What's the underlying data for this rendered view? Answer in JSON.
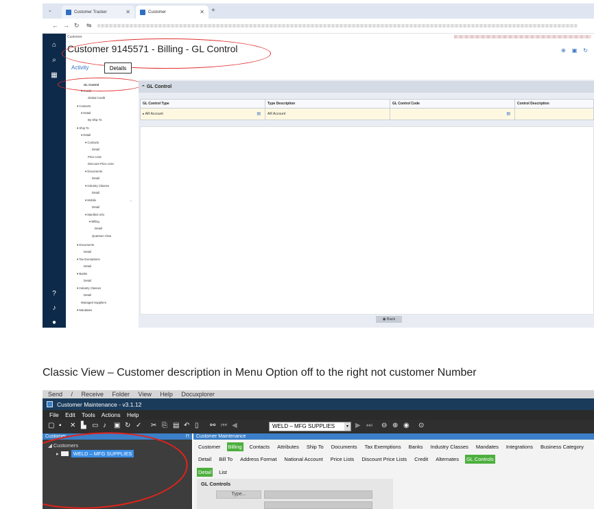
{
  "top": {
    "tabs": [
      {
        "label": "Customer Tracker"
      },
      {
        "label": "Customer"
      }
    ],
    "crumb": "Customer",
    "page_title": "Customer 9145571 - Billing - GL Control",
    "view_tabs": {
      "activity": "Activity",
      "details": "Details"
    },
    "tree": [
      "GL Control",
      "Credit",
      "Global Credit",
      "Contacts",
      "Detail",
      "By Ship To",
      "Ship To",
      "Detail",
      "Contacts",
      "Detail",
      "Price Lists",
      "Discount Price Lists",
      "Documents",
      "Detail",
      "Industry Classes",
      "Detail",
      "Mobile",
      "Detail",
      "Manifest Info",
      "Billing",
      "Detail",
      "Quantum View",
      "Documents",
      "Detail",
      "Tax Exemptions",
      "Detail",
      "Banks",
      "Detail",
      "Industry Classes",
      "Detail",
      "Managed Suppliers",
      "Mandates"
    ],
    "section": "GL Control",
    "grid": {
      "headers": [
        "GL Control Type",
        "Type Description",
        "GL Control Code",
        "Control Description"
      ],
      "row": [
        "AR Account",
        "AR Account",
        "",
        ""
      ]
    },
    "back_label": "Back"
  },
  "caption": "Classic View – Customer description in Menu Option off to the right not customer Number",
  "bottom": {
    "menu_strip": "Send / Receive  Folder  View  Help  Docuxplorer",
    "window_title": "Customer Maintenance - v3.1.12",
    "menu": [
      "File",
      "Edit",
      "Tools",
      "Actions",
      "Help"
    ],
    "record": "WELD – MFG SUPPLIES",
    "left_header": "Customer",
    "pin": "⊓",
    "tree_root": "Customers",
    "tree_child": "WELD – MFG SUPPLIES",
    "right_header": "Customer Maintenance",
    "tabs1": [
      "Customer",
      "Billing",
      "Contacts",
      "Attributes",
      "Ship To",
      "Documents",
      "Tax Exemptions",
      "Banks",
      "Industry Classes",
      "Mandates",
      "Integrations",
      "Business Category"
    ],
    "tabs2": [
      "Detail",
      "Bill To",
      "Address Format",
      "National Account",
      "Price Lists",
      "Discount Price Lists",
      "Credit",
      "Alternates",
      "GL Controls"
    ],
    "tabs3": [
      "Detail",
      "List"
    ],
    "gl_title": "GL Controls",
    "type_btn": "Type..."
  }
}
